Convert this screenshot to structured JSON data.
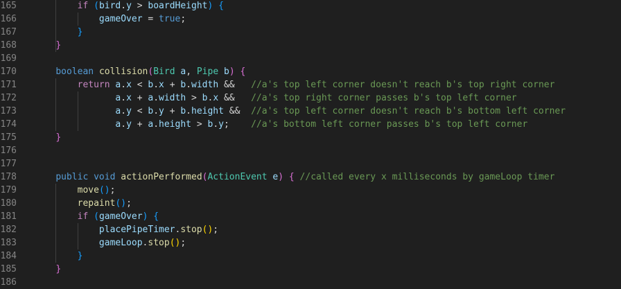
{
  "colors": {
    "background": "#1f1f1f",
    "line_number": "#858585",
    "keyword": "#569cd6",
    "control": "#c586c0",
    "variable": "#9cdcfe",
    "type": "#4ec9b0",
    "function": "#dcdcaa",
    "comment": "#6a9955",
    "bracket_level_1": "#da70d6",
    "bracket_level_2": "#179fff",
    "bracket_level_3": "#ffd700"
  },
  "lines": [
    {
      "number": "165",
      "tokens": [
        {
          "t": "        "
        },
        {
          "t": "if",
          "c": "control"
        },
        {
          "t": " "
        },
        {
          "t": "(",
          "c": "bracket2"
        },
        {
          "t": "bird",
          "c": "var"
        },
        {
          "t": "."
        },
        {
          "t": "y",
          "c": "var"
        },
        {
          "t": " > "
        },
        {
          "t": "boardHeight",
          "c": "var"
        },
        {
          "t": ")",
          "c": "bracket2"
        },
        {
          "t": " "
        },
        {
          "t": "{",
          "c": "bracket2"
        }
      ]
    },
    {
      "number": "166",
      "tokens": [
        {
          "t": "            "
        },
        {
          "t": "gameOver",
          "c": "var"
        },
        {
          "t": " = "
        },
        {
          "t": "true",
          "c": "keyword"
        },
        {
          "t": ";"
        }
      ]
    },
    {
      "number": "167",
      "tokens": [
        {
          "t": "        "
        },
        {
          "t": "}",
          "c": "bracket2"
        }
      ]
    },
    {
      "number": "168",
      "tokens": [
        {
          "t": "    "
        },
        {
          "t": "}",
          "c": "bracket1"
        }
      ]
    },
    {
      "number": "169",
      "tokens": []
    },
    {
      "number": "170",
      "tokens": [
        {
          "t": "    "
        },
        {
          "t": "boolean",
          "c": "keyword"
        },
        {
          "t": " "
        },
        {
          "t": "collision",
          "c": "func"
        },
        {
          "t": "(",
          "c": "bracket1"
        },
        {
          "t": "Bird",
          "c": "type"
        },
        {
          "t": " "
        },
        {
          "t": "a",
          "c": "var"
        },
        {
          "t": ", "
        },
        {
          "t": "Pipe",
          "c": "type"
        },
        {
          "t": " "
        },
        {
          "t": "b",
          "c": "var"
        },
        {
          "t": ")",
          "c": "bracket1"
        },
        {
          "t": " "
        },
        {
          "t": "{",
          "c": "bracket1"
        }
      ]
    },
    {
      "number": "171",
      "tokens": [
        {
          "t": "        "
        },
        {
          "t": "return",
          "c": "control"
        },
        {
          "t": " "
        },
        {
          "t": "a",
          "c": "var"
        },
        {
          "t": "."
        },
        {
          "t": "x",
          "c": "var"
        },
        {
          "t": " < "
        },
        {
          "t": "b",
          "c": "var"
        },
        {
          "t": "."
        },
        {
          "t": "x",
          "c": "var"
        },
        {
          "t": " + "
        },
        {
          "t": "b",
          "c": "var"
        },
        {
          "t": "."
        },
        {
          "t": "width",
          "c": "var"
        },
        {
          "t": " &&   "
        },
        {
          "t": "//a's top left corner doesn't reach b's top right corner",
          "c": "comment"
        }
      ]
    },
    {
      "number": "172",
      "tokens": [
        {
          "t": "               "
        },
        {
          "t": "a",
          "c": "var"
        },
        {
          "t": "."
        },
        {
          "t": "x",
          "c": "var"
        },
        {
          "t": " + "
        },
        {
          "t": "a",
          "c": "var"
        },
        {
          "t": "."
        },
        {
          "t": "width",
          "c": "var"
        },
        {
          "t": " > "
        },
        {
          "t": "b",
          "c": "var"
        },
        {
          "t": "."
        },
        {
          "t": "x",
          "c": "var"
        },
        {
          "t": " &&   "
        },
        {
          "t": "//a's top right corner passes b's top left corner",
          "c": "comment"
        }
      ]
    },
    {
      "number": "173",
      "tokens": [
        {
          "t": "               "
        },
        {
          "t": "a",
          "c": "var"
        },
        {
          "t": "."
        },
        {
          "t": "y",
          "c": "var"
        },
        {
          "t": " < "
        },
        {
          "t": "b",
          "c": "var"
        },
        {
          "t": "."
        },
        {
          "t": "y",
          "c": "var"
        },
        {
          "t": " + "
        },
        {
          "t": "b",
          "c": "var"
        },
        {
          "t": "."
        },
        {
          "t": "height",
          "c": "var"
        },
        {
          "t": " &&  "
        },
        {
          "t": "//a's top left corner doesn't reach b's bottom left corner",
          "c": "comment"
        }
      ]
    },
    {
      "number": "174",
      "tokens": [
        {
          "t": "               "
        },
        {
          "t": "a",
          "c": "var"
        },
        {
          "t": "."
        },
        {
          "t": "y",
          "c": "var"
        },
        {
          "t": " + "
        },
        {
          "t": "a",
          "c": "var"
        },
        {
          "t": "."
        },
        {
          "t": "height",
          "c": "var"
        },
        {
          "t": " > "
        },
        {
          "t": "b",
          "c": "var"
        },
        {
          "t": "."
        },
        {
          "t": "y",
          "c": "var"
        },
        {
          "t": ";    "
        },
        {
          "t": "//a's bottom left corner passes b's top left corner",
          "c": "comment"
        }
      ]
    },
    {
      "number": "175",
      "tokens": [
        {
          "t": "    "
        },
        {
          "t": "}",
          "c": "bracket1"
        }
      ]
    },
    {
      "number": "176",
      "tokens": []
    },
    {
      "number": "177",
      "tokens": []
    },
    {
      "number": "178",
      "tokens": [
        {
          "t": "    "
        },
        {
          "t": "public",
          "c": "keyword"
        },
        {
          "t": " "
        },
        {
          "t": "void",
          "c": "keyword"
        },
        {
          "t": " "
        },
        {
          "t": "actionPerformed",
          "c": "func"
        },
        {
          "t": "(",
          "c": "bracket1"
        },
        {
          "t": "ActionEvent",
          "c": "type"
        },
        {
          "t": " "
        },
        {
          "t": "e",
          "c": "var"
        },
        {
          "t": ")",
          "c": "bracket1"
        },
        {
          "t": " "
        },
        {
          "t": "{",
          "c": "bracket1"
        },
        {
          "t": " "
        },
        {
          "t": "//called every x milliseconds by gameLoop timer",
          "c": "comment"
        }
      ]
    },
    {
      "number": "179",
      "tokens": [
        {
          "t": "        "
        },
        {
          "t": "move",
          "c": "func"
        },
        {
          "t": "(",
          "c": "bracket2"
        },
        {
          "t": ")",
          "c": "bracket2"
        },
        {
          "t": ";"
        }
      ]
    },
    {
      "number": "180",
      "tokens": [
        {
          "t": "        "
        },
        {
          "t": "repaint",
          "c": "func"
        },
        {
          "t": "(",
          "c": "bracket2"
        },
        {
          "t": ")",
          "c": "bracket2"
        },
        {
          "t": ";"
        }
      ]
    },
    {
      "number": "181",
      "tokens": [
        {
          "t": "        "
        },
        {
          "t": "if",
          "c": "control"
        },
        {
          "t": " "
        },
        {
          "t": "(",
          "c": "bracket2"
        },
        {
          "t": "gameOver",
          "c": "var"
        },
        {
          "t": ")",
          "c": "bracket2"
        },
        {
          "t": " "
        },
        {
          "t": "{",
          "c": "bracket2"
        }
      ]
    },
    {
      "number": "182",
      "tokens": [
        {
          "t": "            "
        },
        {
          "t": "placePipeTimer",
          "c": "var"
        },
        {
          "t": "."
        },
        {
          "t": "stop",
          "c": "func"
        },
        {
          "t": "(",
          "c": "bracket3"
        },
        {
          "t": ")",
          "c": "bracket3"
        },
        {
          "t": ";"
        }
      ]
    },
    {
      "number": "183",
      "tokens": [
        {
          "t": "            "
        },
        {
          "t": "gameLoop",
          "c": "var"
        },
        {
          "t": "."
        },
        {
          "t": "stop",
          "c": "func"
        },
        {
          "t": "(",
          "c": "bracket3"
        },
        {
          "t": ")",
          "c": "bracket3"
        },
        {
          "t": ";"
        }
      ]
    },
    {
      "number": "184",
      "tokens": [
        {
          "t": "        "
        },
        {
          "t": "}",
          "c": "bracket2"
        }
      ]
    },
    {
      "number": "185",
      "tokens": [
        {
          "t": "    "
        },
        {
          "t": "}",
          "c": "bracket1"
        }
      ]
    },
    {
      "number": "186",
      "tokens": []
    }
  ]
}
